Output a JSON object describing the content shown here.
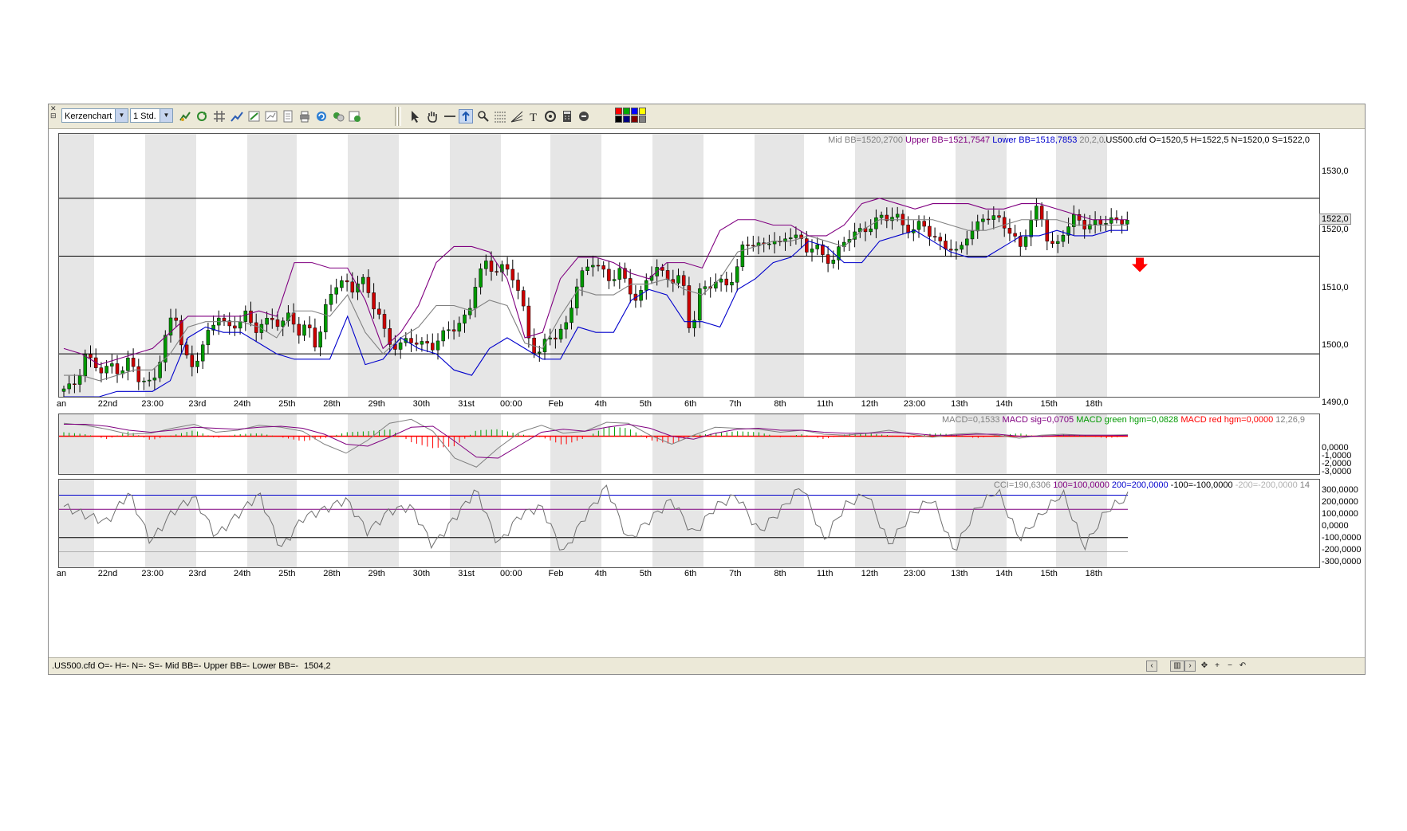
{
  "toolbar": {
    "chart_type": "Kerzenchart",
    "interval": "1 Std.",
    "swatch_colors": [
      "#ff0000",
      "#00aa00",
      "#0000ff",
      "#ffff00",
      "#000000",
      "#000080",
      "#800000",
      "#808080"
    ]
  },
  "price_panel": {
    "legend_mid": "Mid BB=1520,2700",
    "legend_upper": "Upper BB=1521,7547",
    "legend_lower": "Lower BB=1518,7853",
    "legend_params": "20,2,0",
    "legend_ohlc": ".US500.cfd O=1520,5 H=1522,5 N=1520,0 S=1522,0",
    "axis_labels": [
      "1530,0",
      "1522,0",
      "1520,0",
      "1510,0",
      "1500,0",
      "1490,0"
    ],
    "current_price_label": "1522,0",
    "colors": {
      "upper": "#800080",
      "lower": "#0000cc",
      "mid": "#808080",
      "up_candle": "#009900",
      "down_candle": "#cc0000",
      "signal_arrow": "#ff0000"
    }
  },
  "macd_panel": {
    "legend_macd": "MACD=0,1533",
    "legend_sig": "MACD sig=0,0705",
    "legend_green": "MACD green hgm=0,0828",
    "legend_red": "MACD red hgm=0,0000",
    "legend_params": "12,26,9",
    "axis_labels": [
      "0,0000",
      "-1,0000",
      "-2,0000",
      "-3,0000"
    ]
  },
  "cci_panel": {
    "legend_cci": "CCI=190,6306",
    "legend_100": "100=100,0000",
    "legend_200": "200=200,0000",
    "legend_m100": "-100=-100,0000",
    "legend_m200": "-200=-200,0000",
    "legend_period": "14",
    "axis_labels": [
      "300,0000",
      "200,0000",
      "100,0000",
      "0,0000",
      "-100,0000",
      "-200,0000",
      "-300,0000"
    ]
  },
  "time_axis": [
    "an",
    "22nd",
    "23:00",
    "23rd",
    "24th",
    "25th",
    "28th",
    "29th",
    "30th",
    "31st",
    "00:00",
    "Feb",
    "4th",
    "5th",
    "6th",
    "7th",
    "8th",
    "11th",
    "12th",
    "23:00",
    "13th",
    "14th",
    "15th",
    "18th"
  ],
  "status_bar": {
    "text": ".US500.cfd O=- H=- N=- S=-  Mid BB=- Upper BB=- Lower BB=-",
    "value": "1504,2"
  },
  "chart_data": {
    "type": "candlestick",
    "symbol": ".US500.cfd",
    "price_range": [
      1488,
      1537
    ],
    "horizontal_levels": [
      1525,
      1514.2,
      1496
    ],
    "last_bar": {
      "open": 1520.5,
      "high": 1522.5,
      "low": 1520.0,
      "close": 1522.0
    },
    "price_path": [
      1489,
      1489,
      1491,
      1496,
      1494,
      1492,
      1494,
      1493,
      1495,
      1491,
      1490,
      1493,
      1499,
      1504,
      1496,
      1494,
      1497,
      1500,
      1503,
      1501,
      1502,
      1503,
      1500,
      1502,
      1503,
      1501,
      1503,
      1500,
      1502,
      1497,
      1504,
      1509,
      1510,
      1508,
      1510,
      1506,
      1504,
      1498,
      1497,
      1498,
      1499,
      1498,
      1497,
      1499,
      1501,
      1502,
      1503,
      1510,
      1513,
      1512,
      1512,
      1510,
      1506,
      1498,
      1496,
      1499,
      1499,
      1502,
      1508,
      1511,
      1513,
      1512,
      1510,
      1511,
      1508,
      1506,
      1510,
      1512,
      1510,
      1510,
      1511,
      1499,
      1507,
      1509,
      1510,
      1509,
      1510,
      1517,
      1517,
      1516,
      1517,
      1516,
      1519,
      1518,
      1515,
      1516,
      1514,
      1514,
      1516,
      1518,
      1519,
      1520,
      1521,
      1521,
      1522,
      1520,
      1519,
      1520,
      1518,
      1517,
      1516,
      1514,
      1518,
      1520,
      1522,
      1521,
      1520,
      1519,
      1516,
      1520,
      1523,
      1518,
      1516,
      1519,
      1521,
      1520,
      1521,
      1520,
      1521,
      1520,
      1522
    ],
    "bb_upper": [
      1497,
      1496,
      1494,
      1495,
      1496,
      1497,
      1500,
      1503,
      1503,
      1503,
      1503,
      1504,
      1503,
      1513,
      1513,
      1512,
      1512,
      1506,
      1497,
      1500,
      1505,
      1513,
      1516,
      1516,
      1515,
      1510,
      1499,
      1500,
      1510,
      1514,
      1514,
      1513,
      1511,
      1510,
      1513,
      1513,
      1512,
      1519,
      1521,
      1521,
      1520,
      1520,
      1518,
      1518,
      1520,
      1524,
      1525,
      1524,
      1523,
      1524,
      1524,
      1524,
      1523,
      1523,
      1524,
      1524,
      1523,
      1522,
      1521,
      1521,
      1521
    ],
    "bb_lower": [
      1488,
      1488,
      1488,
      1489,
      1489,
      1489,
      1491,
      1499,
      1501,
      1500,
      1500,
      1498,
      1496,
      1495,
      1495,
      1495,
      1503,
      1494,
      1495,
      1499,
      1497,
      1496,
      1493,
      1492,
      1497,
      1499,
      1497,
      1495,
      1495,
      1501,
      1500,
      1500,
      1506,
      1508,
      1507,
      1502,
      1502,
      1501,
      1508,
      1510,
      1513,
      1514,
      1517,
      1516,
      1513,
      1513,
      1517,
      1518,
      1519,
      1517,
      1515,
      1514,
      1514,
      1516,
      1518,
      1518,
      1519,
      1518,
      1518,
      1519,
      1519
    ],
    "bb_mid": [
      1492,
      1492,
      1491,
      1492,
      1493,
      1493,
      1496,
      1501,
      1502,
      1502,
      1502,
      1501,
      1499,
      1504,
      1504,
      1503,
      1507,
      1500,
      1496,
      1499,
      1501,
      1505,
      1505,
      1504,
      1506,
      1505,
      1498,
      1497,
      1503,
      1508,
      1507,
      1507,
      1509,
      1509,
      1510,
      1508,
      1507,
      1510,
      1515,
      1516,
      1517,
      1517,
      1518,
      1517,
      1516,
      1519,
      1521,
      1521,
      1521,
      1521,
      1520,
      1519,
      1519,
      1520,
      1521,
      1521,
      1521,
      1520,
      1520,
      1520,
      1520
    ],
    "macd_range": [
      -3.8,
      2.2
    ],
    "macd_hist": [
      0.4,
      0.2,
      -0.3,
      0.5,
      -0.4,
      0.1,
      0.6,
      -0.2,
      0.2,
      0.3,
      -0.1,
      -0.5,
      -0.2,
      0.4,
      0.5,
      0.7,
      -0.6,
      -1.2,
      -1.0,
      0.6,
      0.7,
      0.2,
      -0.1,
      -0.9,
      -0.2,
      1.0,
      0.8,
      -0.4,
      -0.8,
      0.1,
      0.3,
      0.5,
      0.4,
      -0.1,
      0.2,
      -0.3,
      0.2,
      0.3,
      0.1,
      -0.2,
      0.3,
      0.2,
      -0.2,
      0.1,
      0.3,
      -0.1,
      0.2,
      0.1,
      -0.2,
      0.0
    ],
    "macd_line": [
      1.3,
      1.1,
      0.7,
      0.2,
      0.3,
      0.8,
      1.2,
      0.4,
      0.6,
      1.1,
      0.9,
      0.5,
      -0.8,
      -1.7,
      -0.4,
      1.3,
      1.7,
      0.5,
      -2.2,
      -3.1,
      -1.2,
      0.4,
      1.1,
      0.3,
      0.5,
      1.4,
      1.3,
      0.1,
      -0.8,
      0.1,
      0.9,
      0.8,
      0.7,
      0.4,
      0.6,
      0.2,
      0.1,
      0.3,
      0.6,
      0.2,
      -0.1,
      0.2,
      0.3,
      0.1,
      -0.2,
      0.1,
      0.2,
      0.1,
      0.1,
      0.15
    ],
    "macd_signal": [
      1.2,
      1.2,
      1.0,
      0.6,
      0.4,
      0.6,
      0.9,
      0.8,
      0.7,
      0.9,
      1.0,
      0.8,
      0.2,
      -0.8,
      -1.0,
      -0.1,
      0.9,
      1.0,
      -0.5,
      -2.1,
      -2.2,
      -0.9,
      0.4,
      0.7,
      0.5,
      0.9,
      1.2,
      0.8,
      0.0,
      -0.3,
      0.3,
      0.7,
      0.8,
      0.6,
      0.6,
      0.4,
      0.3,
      0.3,
      0.4,
      0.3,
      0.1,
      0.1,
      0.2,
      0.2,
      0.0,
      0.0,
      0.1,
      0.1,
      0.1,
      0.07
    ],
    "cci_range": [
      -310,
      310
    ],
    "cci_levels": [
      200,
      100,
      -100,
      -200
    ],
    "cci": [
      120,
      60,
      10,
      220,
      -130,
      80,
      190,
      -90,
      60,
      210,
      -180,
      40,
      100,
      170,
      -60,
      90,
      120,
      -160,
      40,
      240,
      -150,
      60,
      120,
      -210,
      50,
      260,
      -120,
      30,
      170,
      -80,
      120,
      200,
      -60,
      90,
      270,
      -120,
      130,
      210,
      -150,
      60,
      180,
      -200,
      100,
      240,
      -110,
      60,
      220,
      -170,
      90,
      190
    ]
  }
}
